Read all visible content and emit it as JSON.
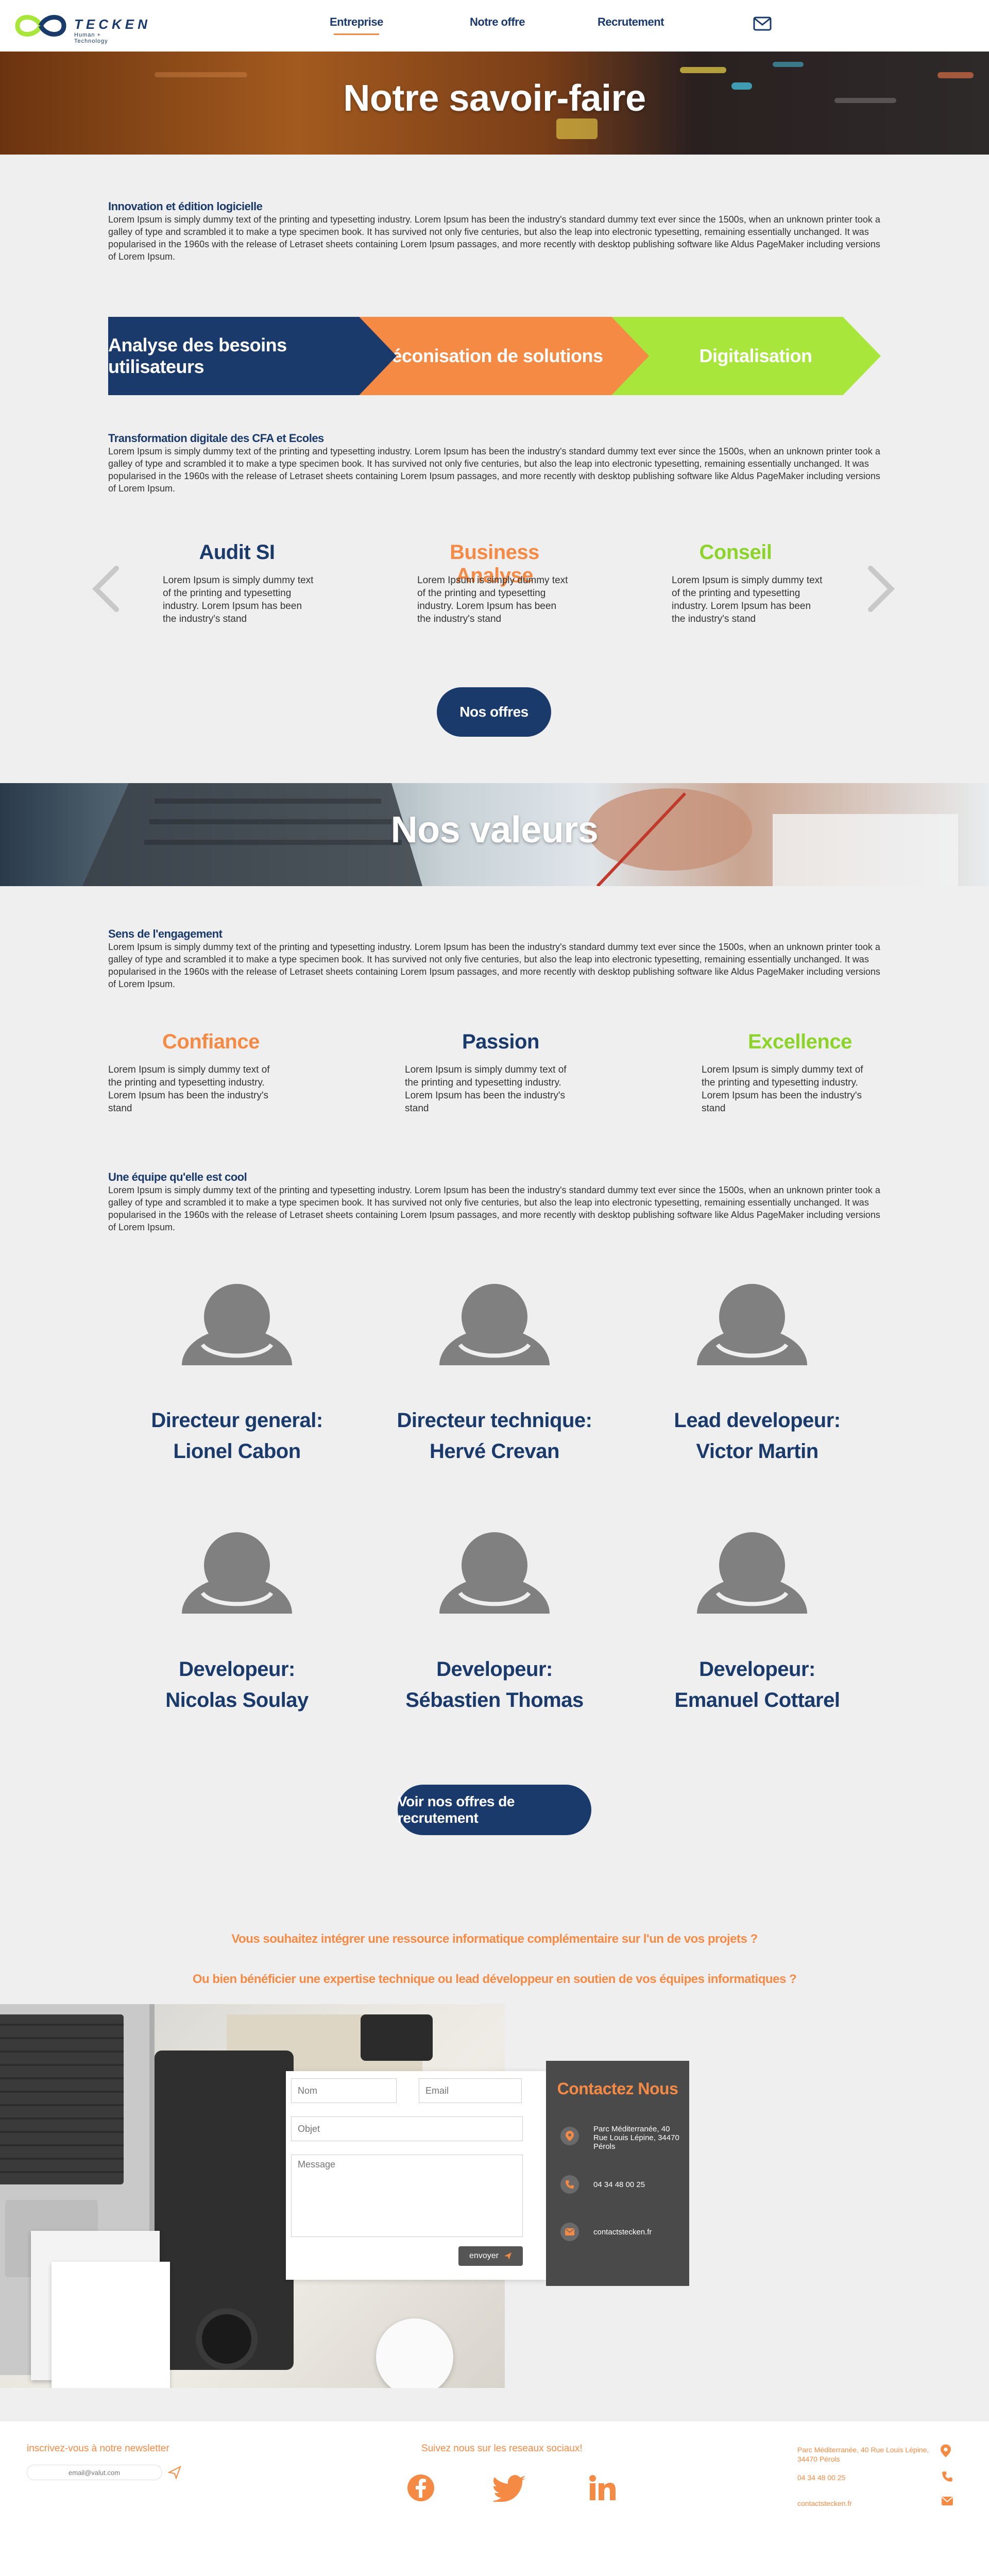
{
  "header": {
    "logo_name": "TECKEN",
    "logo_tagline": "Human + Technology",
    "nav": [
      {
        "label": "Entreprise",
        "active": true
      },
      {
        "label": "Notre offre",
        "active": false
      },
      {
        "label": "Recrutement",
        "active": false
      }
    ],
    "mail_icon": "envelope-icon"
  },
  "hero": {
    "title": "Notre savoir-faire"
  },
  "innovation": {
    "title": "Innovation et édition logicielle",
    "text": "Lorem Ipsum is simply dummy text of the printing and typesetting industry. Lorem Ipsum has been the industry's standard dummy text ever since the 1500s, when an unknown printer took a galley of type and scrambled it to make a type specimen book. It has survived not only five centuries, but also the leap into electronic typesetting, remaining essentially unchanged. It was popularised in the 1960s with the release of Letraset sheets containing Lorem Ipsum passages, and more recently with desktop publishing software like Aldus PageMaker including versions of Lorem Ipsum."
  },
  "process": [
    {
      "label": "Analyse des besoins utilisateurs",
      "color": "#1a3a6b"
    },
    {
      "label": "Préconisation de solutions",
      "color": "#f58a45"
    },
    {
      "label": "Digitalisation",
      "color": "#a8e63c"
    }
  ],
  "transformation": {
    "title": "Transformation digitale des CFA et Ecoles",
    "text": "Lorem Ipsum is simply dummy text of the printing and typesetting industry. Lorem Ipsum has been the industry's standard dummy text ever since the 1500s, when an unknown printer took a galley of type and scrambled it to make a type specimen book. It has survived not only five centuries, but also the leap into electronic typesetting, remaining essentially unchanged. It was popularised in the 1960s with the release of Letraset sheets containing Lorem Ipsum passages, and more recently with desktop publishing software like Aldus PageMaker including versions of Lorem Ipsum."
  },
  "services": [
    {
      "title": "Audit SI",
      "color": "#1a3a6b",
      "text": "Lorem Ipsum is simply dummy text of the printing and typesetting industry. Lorem Ipsum has been the industry's stand"
    },
    {
      "title": "Business Analyse",
      "color": "#f58a45",
      "text": "Lorem Ipsum is simply dummy text of the printing and typesetting industry. Lorem Ipsum has been the industry's stand"
    },
    {
      "title": "Conseil",
      "color": "#8dd42a",
      "text": "Lorem Ipsum is simply dummy text of the printing and typesetting industry. Lorem Ipsum has been the industry's stand"
    }
  ],
  "offers_button": "Nos offres",
  "values_banner": {
    "title": "Nos valeurs"
  },
  "engagement": {
    "title": "Sens de l'engagement",
    "text": "Lorem Ipsum is simply dummy text of the printing and typesetting industry. Lorem Ipsum has been the industry's standard dummy text ever since the 1500s, when an unknown printer took a galley of type and scrambled it to make a type specimen book. It has survived not only five centuries, but also the leap into electronic typesetting, remaining essentially unchanged. It was popularised in the 1960s with the release of Letraset sheets containing Lorem Ipsum passages, and more recently with desktop publishing software like Aldus PageMaker including versions of Lorem Ipsum."
  },
  "values": [
    {
      "title": "Confiance",
      "color": "#f58a45",
      "text": "Lorem Ipsum is simply dummy text of the printing and typesetting industry. Lorem Ipsum has been the industry's stand"
    },
    {
      "title": "Passion",
      "color": "#1a3a6b",
      "text": "Lorem Ipsum is simply dummy text of the printing and typesetting industry. Lorem Ipsum has been the industry's stand"
    },
    {
      "title": "Excellence",
      "color": "#8dd42a",
      "text": "Lorem Ipsum is simply dummy text of the printing and typesetting industry. Lorem Ipsum has been the industry's stand"
    }
  ],
  "team_intro": {
    "title": "Une équipe qu'elle est cool",
    "text": "Lorem Ipsum is simply dummy text of the printing and typesetting industry. Lorem Ipsum has been the industry's standard dummy text ever since the 1500s, when an unknown printer took a galley of type and scrambled it to make a type specimen book. It has survived not only five centuries, but also the leap into electronic typesetting, remaining essentially unchanged. It was popularised in the 1960s with the release of Letraset sheets containing Lorem Ipsum passages, and more recently with desktop publishing software like Aldus PageMaker including versions of Lorem Ipsum."
  },
  "team": [
    {
      "role": "Directeur general:",
      "name": "Lionel Cabon"
    },
    {
      "role": "Directeur technique:",
      "name": "Hervé Crevan"
    },
    {
      "role": "Lead developeur:",
      "name": "Victor Martin"
    },
    {
      "role": "Developeur:",
      "name": "Nicolas Soulay"
    },
    {
      "role": "Developeur:",
      "name": "Sébastien Thomas"
    },
    {
      "role": "Developeur:",
      "name": "Emanuel Cottarel"
    }
  ],
  "recruit_button": "Voir nos offres de recrutement",
  "questions": [
    "Vous souhaitez intégrer une ressource informatique complémentaire sur l'un de vos projets ?",
    "Ou bien bénéficier une expertise technique ou lead développeur en soutien de vos équipes informatiques ?"
  ],
  "form": {
    "name_placeholder": "Nom",
    "email_placeholder": "Email",
    "subject_placeholder": "Objet",
    "message_placeholder": "Message",
    "send_label": "envoyer"
  },
  "contact": {
    "title": "Contactez Nous",
    "address": "Parc Méditerranée, 40 Rue Louis Lépine, 34470 Pérols",
    "phone": "04 34 48 00 25",
    "email": "contactstecken.fr"
  },
  "footer": {
    "newsletter_label": "inscrivez-vous à notre newsletter",
    "newsletter_placeholder": "email@valut.com",
    "social_label": "Suivez nous sur les reseaux sociaux!",
    "social": [
      "facebook-icon",
      "twitter-icon",
      "linkedin-icon"
    ],
    "address": "Parc Méditerranée, 40 Rue Louis Lépine, 34470 Pérols",
    "phone": "04 34 48 00 25",
    "email": "contactstecken.fr"
  },
  "colors": {
    "navy": "#1a3a6b",
    "orange": "#f58a45",
    "green": "#a8e63c",
    "background": "#efefef"
  }
}
